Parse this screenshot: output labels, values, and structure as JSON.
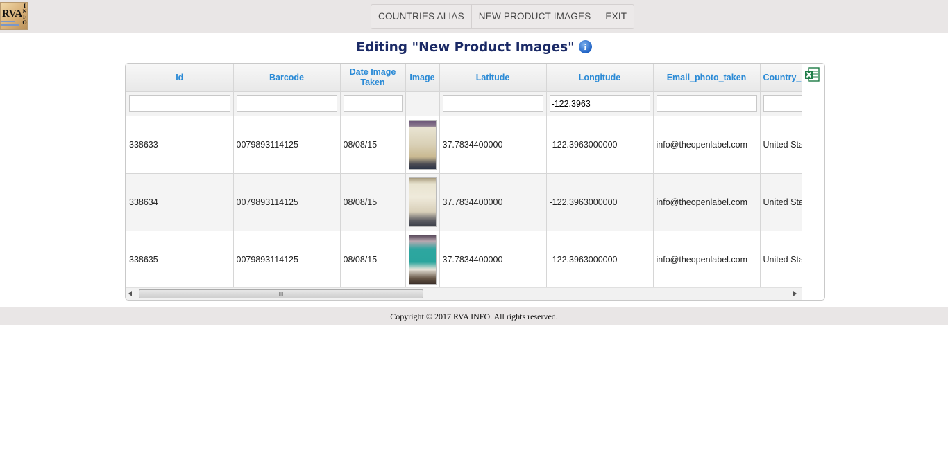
{
  "app": {
    "logo_text": "RVA",
    "logo_side_text": "INFO"
  },
  "menu": {
    "items": [
      {
        "label": "COUNTRIES ALIAS"
      },
      {
        "label": "NEW PRODUCT IMAGES"
      },
      {
        "label": "EXIT"
      }
    ]
  },
  "page": {
    "title": "Editing \"New Product Images\"",
    "info_icon": "info-icon",
    "export_icon": "excel-icon"
  },
  "grid": {
    "columns": [
      {
        "label": "Id"
      },
      {
        "label": "Barcode"
      },
      {
        "label": "Date Image Taken"
      },
      {
        "label": "Image"
      },
      {
        "label": "Latitude"
      },
      {
        "label": "Longitude"
      },
      {
        "label": "Email_photo_taken"
      },
      {
        "label": "Country_"
      }
    ],
    "filters": {
      "id": "",
      "barcode": "",
      "date": "",
      "latitude": "",
      "longitude": "-122.3963",
      "email": "",
      "country": ""
    },
    "rows": [
      {
        "id": "338633",
        "barcode": "0079893114125",
        "date": "08/08/15",
        "latitude": "37.7834400000",
        "longitude": "-122.3963000000",
        "email": "info@theopenlabel.com",
        "country": "United States"
      },
      {
        "id": "338634",
        "barcode": "0079893114125",
        "date": "08/08/15",
        "latitude": "37.7834400000",
        "longitude": "-122.3963000000",
        "email": "info@theopenlabel.com",
        "country": "United States"
      },
      {
        "id": "338635",
        "barcode": "0079893114125",
        "date": "08/08/15",
        "latitude": "37.7834400000",
        "longitude": "-122.3963000000",
        "email": "info@theopenlabel.com",
        "country": "United States"
      }
    ],
    "scroll_grip": "III"
  },
  "footer": {
    "copyright": "Copyright © 2017 RVA INFO. All rights reserved."
  }
}
